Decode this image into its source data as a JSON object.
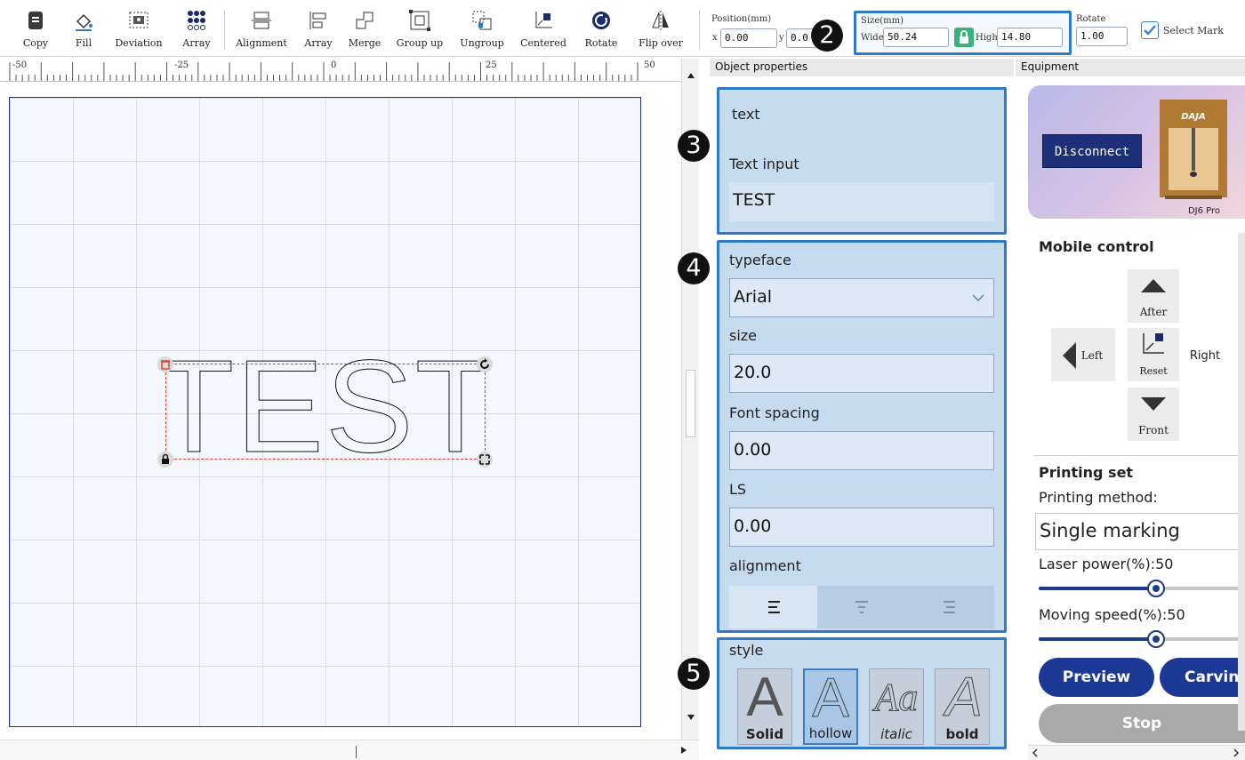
{
  "toolbar": {
    "buttons": [
      {
        "label": "Copy",
        "icon": "copy-icon"
      },
      {
        "label": "Fill",
        "icon": "fill-bucket-icon"
      },
      {
        "label": "Deviation",
        "icon": "deviation-icon"
      },
      {
        "label": "Array",
        "icon": "dot-grid-icon"
      },
      {
        "label": "Alignment",
        "icon": "alignment-icon"
      },
      {
        "label": "Array",
        "icon": "array-layout-icon"
      },
      {
        "label": "Merge",
        "icon": "merge-icon"
      },
      {
        "label": "Group up",
        "icon": "group-icon"
      },
      {
        "label": "Ungroup",
        "icon": "ungroup-icon"
      },
      {
        "label": "Centered",
        "icon": "centered-icon"
      },
      {
        "label": "Rotate",
        "icon": "rotate-icon"
      },
      {
        "label": "Flip over",
        "icon": "flip-icon"
      }
    ],
    "position": {
      "label": "Position(mm)",
      "x_label": "x",
      "x_value": "0.00",
      "y_label": "y",
      "y_value": "0.0"
    },
    "size": {
      "label": "Size(mm)",
      "wide_label": "Wide",
      "wide_value": "50.24",
      "high_label": "High",
      "high_value": "14.80"
    },
    "rotate": {
      "label": "Rotate",
      "value": "1.00"
    },
    "select_mark": {
      "label": "Select Mark",
      "checked": true
    }
  },
  "ruler": {
    "ticks": [
      "-50",
      "-25",
      "0",
      "25",
      "50"
    ]
  },
  "canvas": {
    "text": "TEST"
  },
  "badges": [
    "2",
    "3",
    "4",
    "5"
  ],
  "object_properties": {
    "header": "Object properties",
    "object_type": "text",
    "text_input_label": "Text input",
    "text_input_value": "TEST",
    "typeface_label": "typeface",
    "typeface_value": "Arial",
    "size_label": "size",
    "size_value": "20.0",
    "font_spacing_label": "Font spacing",
    "font_spacing_value": "0.00",
    "ls_label": "LS",
    "ls_value": "0.00",
    "alignment_label": "alignment",
    "style_label": "style",
    "styles": [
      {
        "glyph": "A",
        "label": "Solid"
      },
      {
        "glyph": "A",
        "label": "hollow"
      },
      {
        "glyph": "Aa",
        "label": "italic"
      },
      {
        "glyph": "A",
        "label": "bold"
      }
    ],
    "selected_style": "hollow"
  },
  "equipment": {
    "header": "Equipment",
    "disconnect_label": "Disconnect",
    "device_brand": "DAJA",
    "device_model": "DJ6 Pro",
    "mobile_control_title": "Mobile control",
    "moves": {
      "after": "After",
      "left": "Left",
      "reset": "Reset",
      "right": "Right",
      "front": "Front"
    },
    "printing_set_title": "Printing set",
    "printing_method_label": "Printing method:",
    "printing_method_value": "Single marking",
    "laser_power_label": "Laser power(%):50",
    "laser_power": 50,
    "moving_speed_label": "Moving speed(%):50",
    "moving_speed": 50,
    "preview_label": "Preview",
    "carving_label": "Carving",
    "stop_label": "Stop"
  },
  "colors": {
    "accent": "#2f7ac5",
    "button": "#1a3894",
    "panel": "#c7dbee"
  }
}
